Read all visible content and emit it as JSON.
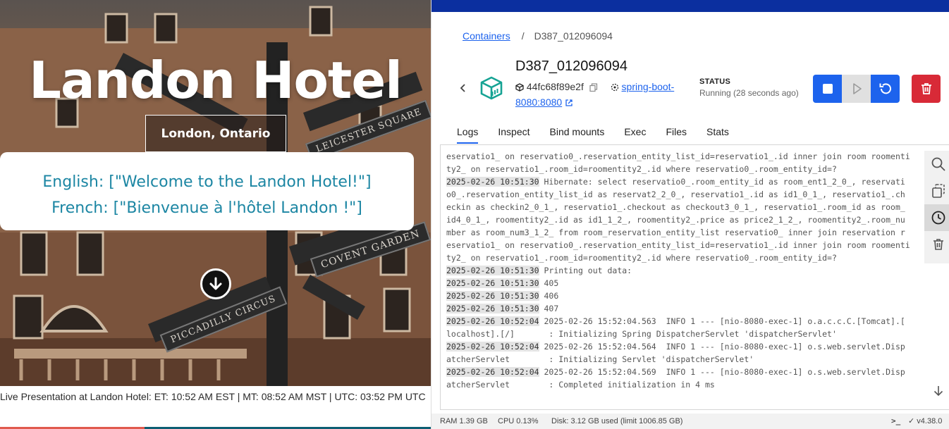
{
  "hotel": {
    "title": "Landon Hotel",
    "subtitle": "London, Ontario",
    "welcome_en": "English: [\"Welcome to the Landon Hotel!\"]",
    "welcome_fr": "French: [\"Bienvenue à l'hôtel Landon !\"]",
    "street_signs": [
      "LEICESTER SQUARE",
      "COVENT GARDEN",
      "PICCADILLY CIRCUS"
    ],
    "ticker": "Live Presentation at Landon Hotel: ET: 10:52 AM EST | MT: 08:52 AM MST | UTC: 03:52 PM UTC"
  },
  "docker": {
    "breadcrumb": {
      "parent": "Containers",
      "separator": "/",
      "current": "D387_012096094"
    },
    "container": {
      "name": "D387_012096094",
      "id": "44fc68f89e2f",
      "image_link_line1": "spring-boot-",
      "image_link_line2": "8080:8080"
    },
    "status": {
      "label": "STATUS",
      "value": "Running (28 seconds ago)"
    },
    "tabs": [
      {
        "label": "Logs",
        "active": true
      },
      {
        "label": "Inspect",
        "active": false
      },
      {
        "label": "Bind mounts",
        "active": false
      },
      {
        "label": "Exec",
        "active": false
      },
      {
        "label": "Files",
        "active": false
      },
      {
        "label": "Stats",
        "active": false
      }
    ],
    "logs": [
      {
        "ts": "",
        "text": "eservatio1_ on reservatio0_.reservation_entity_list_id=reservatio1_.id inner join room roomenti"
      },
      {
        "ts": "",
        "text": "ty2_ on reservatio1_.room_id=roomentity2_.id where reservatio0_.room_entity_id=?"
      },
      {
        "ts": "2025-02-26 10:51:30",
        "text": " Hibernate: select reservatio0_.room_entity_id as room_ent1_2_0_, reservati"
      },
      {
        "ts": "",
        "text": "o0_.reservation_entity_list_id as reservat2_2_0_, reservatio1_.id as id1_0_1_, reservatio1_.ch"
      },
      {
        "ts": "",
        "text": "eckin as checkin2_0_1_, reservatio1_.checkout as checkout3_0_1_, reservatio1_.room_id as room_"
      },
      {
        "ts": "",
        "text": "id4_0_1_, roomentity2_.id as id1_1_2_, roomentity2_.price as price2_1_2_, roomentity2_.room_nu"
      },
      {
        "ts": "",
        "text": "mber as room_num3_1_2_ from room_reservation_entity_list reservatio0_ inner join reservation r"
      },
      {
        "ts": "",
        "text": "eservatio1_ on reservatio0_.reservation_entity_list_id=reservatio1_.id inner join room roomenti"
      },
      {
        "ts": "",
        "text": "ty2_ on reservatio1_.room_id=roomentity2_.id where reservatio0_.room_entity_id=?"
      },
      {
        "ts": "2025-02-26 10:51:30",
        "text": " Printing out data:"
      },
      {
        "ts": "2025-02-26 10:51:30",
        "text": " 405"
      },
      {
        "ts": "2025-02-26 10:51:30",
        "text": " 406"
      },
      {
        "ts": "2025-02-26 10:51:30",
        "text": " 407"
      },
      {
        "ts": "2025-02-26 10:52:04",
        "text": " 2025-02-26 15:52:04.563  INFO 1 --- [nio-8080-exec-1] o.a.c.c.C.[Tomcat].["
      },
      {
        "ts": "",
        "text": "localhost].[/]       : Initializing Spring DispatcherServlet 'dispatcherServlet'"
      },
      {
        "ts": "2025-02-26 10:52:04",
        "text": " 2025-02-26 15:52:04.564  INFO 1 --- [nio-8080-exec-1] o.s.web.servlet.Disp"
      },
      {
        "ts": "",
        "text": "atcherServlet        : Initializing Servlet 'dispatcherServlet'"
      },
      {
        "ts": "2025-02-26 10:52:04",
        "text": " 2025-02-26 15:52:04.569  INFO 1 --- [nio-8080-exec-1] o.s.web.servlet.Disp"
      },
      {
        "ts": "",
        "text": "atcherServlet        : Completed initialization in 4 ms"
      }
    ],
    "footer": {
      "ram": "RAM 1.39 GB",
      "cpu": "CPU 0.13%",
      "disk": "Disk: 3.12 GB used (limit 1006.85 GB)",
      "terminal": ">_",
      "version": "✓ v4.38.0"
    },
    "colors": {
      "accent": "#1d63ed",
      "danger": "#d82a37",
      "topbar": "#0b2f9f"
    }
  }
}
